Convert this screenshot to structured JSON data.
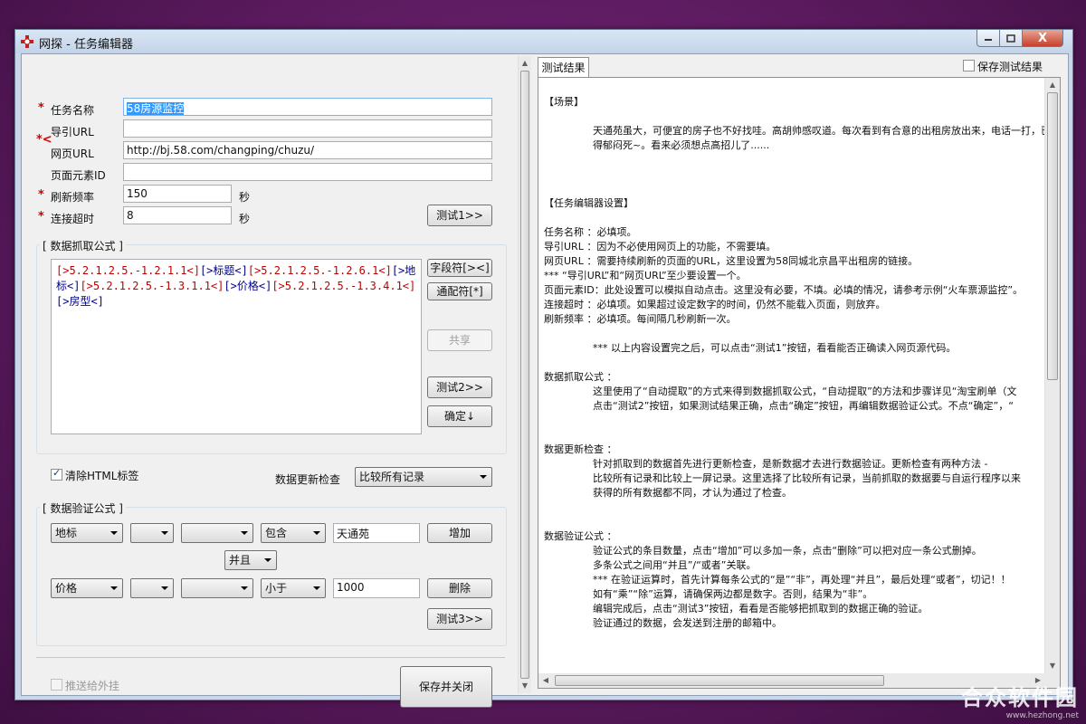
{
  "window": {
    "title": "网探 - 任务编辑器",
    "close_glyph": "X"
  },
  "form": {
    "task_name": {
      "label": "任务名称",
      "value": "58房源监控"
    },
    "referrer_url": {
      "label": "导引URL",
      "value": ""
    },
    "page_url": {
      "label": "网页URL",
      "value": "http://bj.58.com/changping/chuzu/"
    },
    "page_element_id": {
      "label": "页面元素ID",
      "value": ""
    },
    "refresh_rate": {
      "label": "刷新频率",
      "value": "150",
      "unit": "秒"
    },
    "timeout": {
      "label": "连接超时",
      "value": "8",
      "unit": "秒"
    },
    "required_mark": "*",
    "stray_mark": "*<",
    "test1_label": "测试1>>"
  },
  "extraction": {
    "group_title": "[ 数据抓取公式 ]",
    "formula_parts": [
      {
        "t": "[>5.2.1.2.5.-1.2.1.1<]",
        "c": "r"
      },
      {
        "t": "[>标题<]",
        "c": "b"
      },
      {
        "t": "[>5.2.1.2.5.-1.2.6.1<]",
        "c": "r"
      },
      {
        "t": "[>地标<]",
        "c": "b"
      },
      {
        "t": "[>5.2.1.2.5.-1.3.1.1<]",
        "c": "r"
      },
      {
        "t": "[>价格<]",
        "c": "b"
      },
      {
        "t": "[>5.2.1.2.5.-1.3.4.1<]",
        "c": "r"
      },
      {
        "t": "[>房型<]",
        "c": "b"
      }
    ],
    "field_btn": "字段符[><]",
    "wildcard_btn": "通配符[*]",
    "share_btn": "共享",
    "test2_btn": "测试2>>",
    "ok_btn": "确定↓"
  },
  "options": {
    "strip_html_label": "清除HTML标签",
    "strip_html_checked": true,
    "update_check_label": "数据更新检查",
    "update_check_value": "比较所有记录"
  },
  "validation": {
    "group_title": "[ 数据验证公式 ]",
    "rows": [
      {
        "field": "地标",
        "op1": "",
        "op2": "",
        "cmp": "包含",
        "value": "天通苑"
      },
      {
        "field": "价格",
        "op1": "",
        "op2": "",
        "cmp": "小于",
        "value": "1000"
      }
    ],
    "logic": "并且",
    "add_btn": "增加",
    "delete_btn": "删除",
    "test3_btn": "测试3>>"
  },
  "bottom": {
    "push_label": "推送给外挂",
    "push_checked": false,
    "save_close_btn": "保存并关闭"
  },
  "results": {
    "tab_label": "测试结果",
    "save_results_label": "保存测试结果",
    "save_results_checked": false,
    "lines": [
      {
        "text": "【场景】",
        "indent": 0,
        "gap": 0
      },
      {
        "text": "天通苑虽大，可便宜的房子也不好找哇。高胡帅感叹道。每次看到有合意的出租房放出来，电话一打，已",
        "indent": 1,
        "gap": 1
      },
      {
        "text": "得郁闷死~。看来必须想点高招儿了......",
        "indent": 1,
        "gap": 0
      },
      {
        "text": "【任务编辑器设置】",
        "indent": 0,
        "gap": 3
      },
      {
        "text": "任务名称    ：必填项。",
        "indent": 0,
        "gap": 1
      },
      {
        "text": "导引URL                ：因为不必使用网页上的功能，不需要填。",
        "indent": 0,
        "gap": 0
      },
      {
        "text": "网页URL                ：需要持续刷新的页面的URL，这里设置为58同城北京昌平出租房的链接。",
        "indent": 0,
        "gap": 0
      },
      {
        "text": "              ***  “导引URL”和“网页URL”至少要设置一个。",
        "indent": 0,
        "gap": 0
      },
      {
        "text": "页面元素ID：此处设置可以模拟自动点击。这里没有必要，不填。必填的情况，请参考示例“火车票源监控”。",
        "indent": 0,
        "gap": 0
      },
      {
        "text": "连接超时    ：必填项。如果超过设定数字的时间，仍然不能载入页面，则放弃。",
        "indent": 0,
        "gap": 0
      },
      {
        "text": "刷新频率    ：必填项。每间隔几秒刷新一次。",
        "indent": 0,
        "gap": 0
      },
      {
        "text": "*** 以上内容设置完之后，可以点击“测试1”按钮，看看能否正确读入网页源代码。",
        "indent": 1,
        "gap": 1
      },
      {
        "text": "数据抓取公式              ：",
        "indent": 0,
        "gap": 1
      },
      {
        "text": "这里使用了“自动提取”的方式来得到数据抓取公式，“自动提取”的方法和步骤详见“淘宝刷单（文",
        "indent": 1,
        "gap": 0
      },
      {
        "text": "点击“测试2”按钮，如果测试结果正确，点击“确定”按钮，再编辑数据验证公式。不点“确定”，“",
        "indent": 1,
        "gap": 0
      },
      {
        "text": "数据更新检查              ：",
        "indent": 0,
        "gap": 2
      },
      {
        "text": "针对抓取到的数据首先进行更新检查，是新数据才去进行数据验证。更新检查有两种方法 -",
        "indent": 1,
        "gap": 0
      },
      {
        "text": "比较所有记录和比较上一屏记录。这里选择了比较所有记录，当前抓取的数据要与自运行程序以来",
        "indent": 1,
        "gap": 0
      },
      {
        "text": "获得的所有数据都不同，才认为通过了检查。",
        "indent": 1,
        "gap": 0
      },
      {
        "text": "数据验证公式              ：",
        "indent": 0,
        "gap": 2
      },
      {
        "text": "验证公式的条目数量，点击“增加”可以多加一条，点击“删除”可以把对应一条公式删掉。",
        "indent": 1,
        "gap": 0
      },
      {
        "text": "多条公式之间用“并且”/“或者”关联。",
        "indent": 1,
        "gap": 0
      },
      {
        "text": "*** 在验证运算时，首先计算每条公式的“是”“非”，再处理“并且”，最后处理“或者”，切记！！",
        "indent": 1,
        "gap": 0
      },
      {
        "text": "如有“乘”“除”运算，请确保两边都是数字。否则，结果为“非”。",
        "indent": 1,
        "gap": 0
      },
      {
        "text": "编辑完成后，点击“测试3”按钮，看看是否能够把抓取到的数据正确的验证。",
        "indent": 1,
        "gap": 0
      },
      {
        "text": "验证通过的数据，会发送到注册的邮箱中。",
        "indent": 1,
        "gap": 0
      }
    ]
  },
  "watermark": {
    "main": "合众软件园",
    "sub": "www.hezhong.net"
  },
  "colors": {
    "accent_selection": "#3399ff",
    "required": "#d40000",
    "formula_code": "#c00000",
    "formula_field": "#00008b"
  }
}
